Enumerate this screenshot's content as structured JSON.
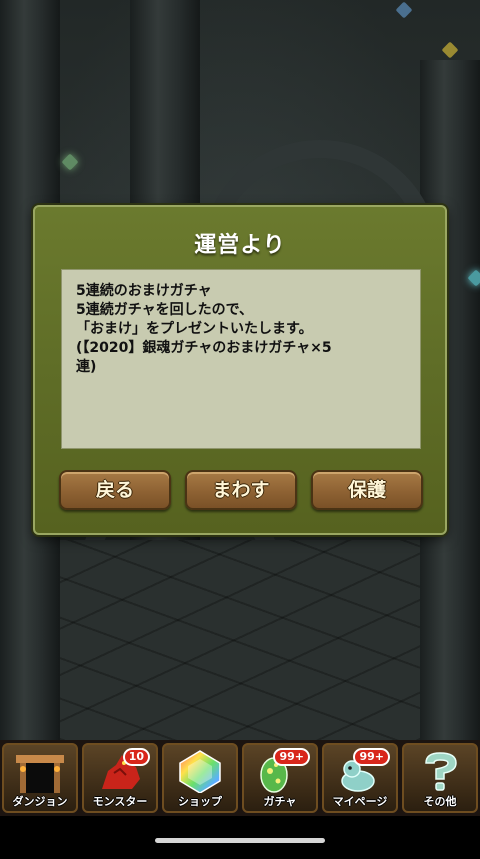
{
  "dialog": {
    "title": "運営より",
    "message_lines": [
      "5連続のおまけガチャ",
      "",
      "5連続ガチャを回したので、",
      "「おまけ」をプレゼントいたします。",
      "(【2020】銀魂ガチャのおまけガチャ×5",
      "連)"
    ],
    "buttons": {
      "back": "戻る",
      "spin": "まわす",
      "protect": "保護"
    }
  },
  "bottom_nav": {
    "items": [
      {
        "label": "ダンジョン",
        "icon": "dungeon-gate-icon",
        "badge": ""
      },
      {
        "label": "モンスター",
        "icon": "red-dragon-icon",
        "badge": "10"
      },
      {
        "label": "ショップ",
        "icon": "rainbow-gem-icon",
        "badge": ""
      },
      {
        "label": "ガチャ",
        "icon": "egg-icon",
        "badge": "99+"
      },
      {
        "label": "マイページ",
        "icon": "monster-pet-icon",
        "badge": "99+"
      },
      {
        "label": "その他",
        "icon": "question-mark-icon",
        "badge": ""
      }
    ]
  },
  "colors": {
    "dialog_bg": "#5f6d27",
    "message_bg": "#c8cbb0",
    "button_bg": "#8e6233",
    "badge_red": "#d8261b"
  }
}
